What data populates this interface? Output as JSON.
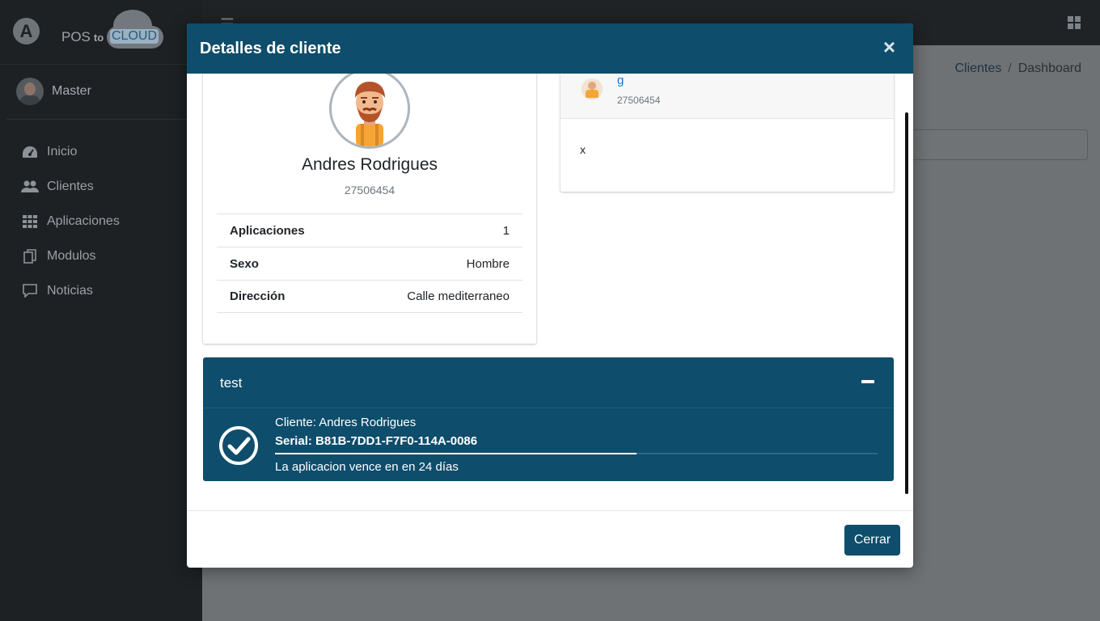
{
  "brand": {
    "logo_letter": "A",
    "pos_label": "POS",
    "to_label": "to",
    "cloud_label": "CLOUD"
  },
  "user": {
    "name": "Master"
  },
  "sidebar": {
    "items": [
      {
        "label": "Inicio",
        "icon": "tachometer-icon"
      },
      {
        "label": "Clientes",
        "icon": "users-icon"
      },
      {
        "label": "Aplicaciones",
        "icon": "th-grid-icon"
      },
      {
        "label": "Modulos",
        "icon": "copy-icon"
      },
      {
        "label": "Noticias",
        "icon": "comment-icon"
      }
    ]
  },
  "breadcrumb": {
    "link": "Clientes",
    "separator": "/",
    "current": "Dashboard"
  },
  "modal": {
    "title": "Detalles de cliente",
    "close_symbol": "×",
    "footer_button": "Cerrar"
  },
  "profile": {
    "name": "Andres Rodrigues",
    "id": "27506454",
    "rows": [
      {
        "key": "Aplicaciones",
        "value": "1"
      },
      {
        "key": "Sexo",
        "value": "Hombre"
      },
      {
        "key": "Dirección",
        "value": "Calle mediterraneo"
      }
    ]
  },
  "comment": {
    "name": "g",
    "sub": "27506454",
    "text": "x"
  },
  "app": {
    "title": "test",
    "client": "Cliente: Andres Rodrigues",
    "serial": "Serial: B81B-7DD1-F7F0-114A-0086",
    "progress_fraction": 0.6,
    "expiry": "La aplicacion vence en en 24 días"
  },
  "colors": {
    "primary": "#0e4d6b",
    "sidebar": "#1d2124",
    "link": "#1a73c8"
  }
}
